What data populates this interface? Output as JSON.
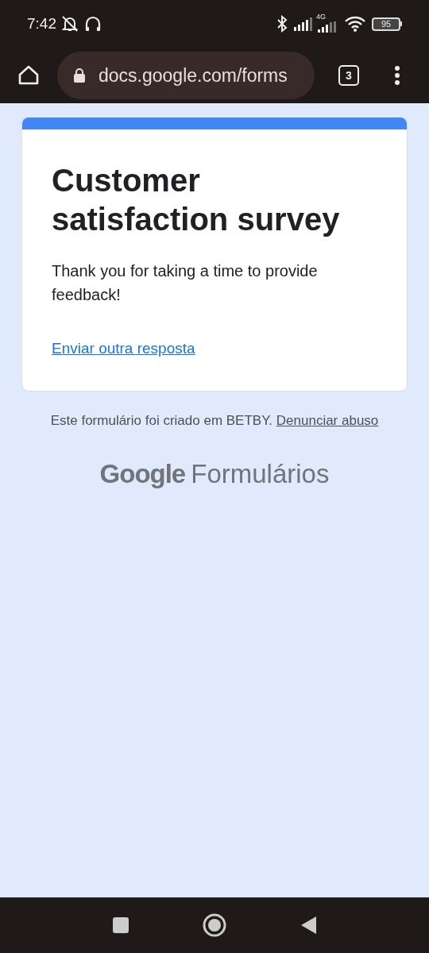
{
  "status_bar": {
    "time": "7:42",
    "network": "4G",
    "battery": "95"
  },
  "browser": {
    "url": "docs.google.com/forms",
    "tab_count": "3"
  },
  "form": {
    "title": "Customer satisfaction survey",
    "message": "Thank you for taking a time to provide feedback!",
    "link": "Enviar outra resposta"
  },
  "footer": {
    "note": "Este formulário foi criado em BETBY.",
    "report_link": "Denunciar abuso",
    "logo_brand": "Google",
    "logo_product": "Formulários"
  }
}
